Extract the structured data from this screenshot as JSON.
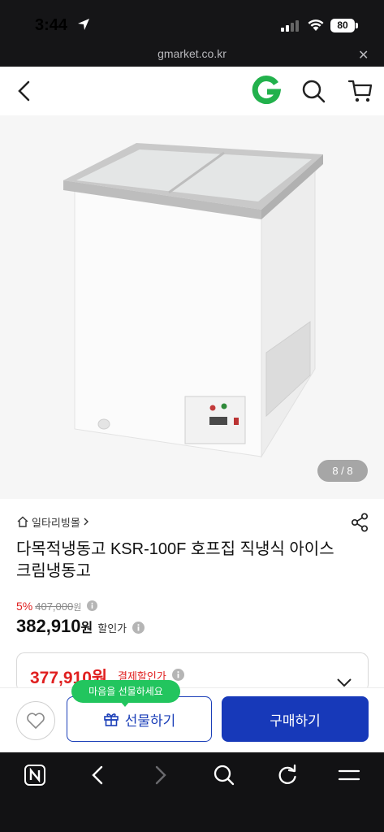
{
  "status_bar": {
    "time": "3:44",
    "battery": "80"
  },
  "url_bar": {
    "domain": "gmarket.co.kr"
  },
  "header": {
    "logo": "G"
  },
  "gallery": {
    "counter": "8 / 8"
  },
  "product": {
    "category": "일타리빙몰",
    "title": "다목적냉동고 KSR-100F 호프집 직냉식 아이스크림냉동고",
    "discount_rate": "5%",
    "original_price": "407,000",
    "original_price_unit": "원",
    "price": "382,910",
    "price_unit": "원",
    "price_label": "할인가"
  },
  "coupon": {
    "price": "377,910원",
    "label": "결제할인가"
  },
  "actions": {
    "gift_tooltip": "마음을 선물하세요",
    "gift_label": "선물하기",
    "buy_label": "구매하기"
  },
  "colors": {
    "accent_blue": "#1739b9",
    "sale_red": "#e02020",
    "gmarket_green": "#22c55e"
  }
}
